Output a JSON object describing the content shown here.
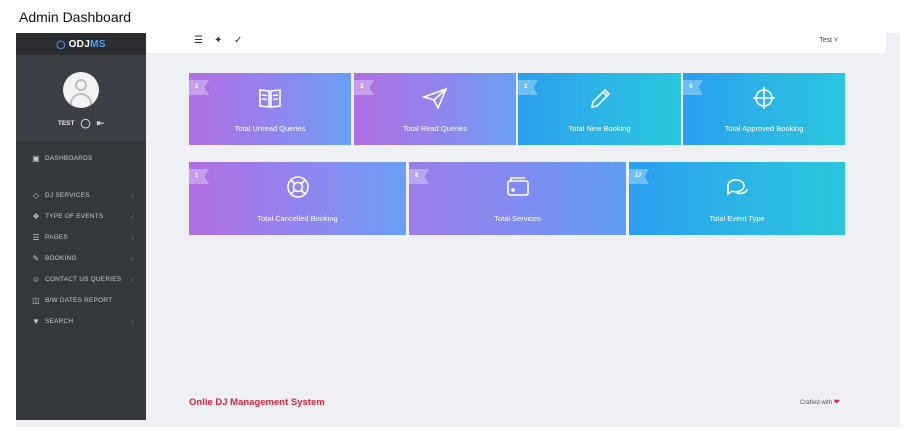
{
  "caption": "Admin Dashboard",
  "brand": {
    "prefix": "ODJ",
    "suffix": "MS"
  },
  "user": {
    "name": "TEST"
  },
  "topbar": {
    "user_menu": "Test ˅"
  },
  "menu": [
    {
      "label": "DASHBOARDS",
      "icon": "dashboard-icon",
      "chevron": false
    },
    {
      "label": "DJ SERVICES",
      "icon": "tag-icon",
      "chevron": true
    },
    {
      "label": "TYPE OF EVENTS",
      "icon": "bolt-icon",
      "chevron": true
    },
    {
      "label": "PAGES",
      "icon": "layers-icon",
      "chevron": true
    },
    {
      "label": "BOOKING",
      "icon": "edit-icon",
      "chevron": true
    },
    {
      "label": "CONTACT US QUERIES",
      "icon": "user-icon",
      "chevron": true
    },
    {
      "label": "B/W DATES REPORT",
      "icon": "calendar-icon",
      "chevron": false
    },
    {
      "label": "SEARCH",
      "icon": "filter-icon",
      "chevron": true
    }
  ],
  "cards": [
    {
      "count": "1",
      "label": "Total Unread Queries",
      "icon": "book-icon",
      "color": "#9b7de9"
    },
    {
      "count": "3",
      "label": "Total Read Queries",
      "icon": "send-icon",
      "color": "#9b7de9"
    },
    {
      "count": "2",
      "label": "Total New Booking",
      "icon": "pencil-icon",
      "color": "#2bb2e8"
    },
    {
      "count": "4",
      "label": "Total Approved Booking",
      "icon": "crosshair-icon",
      "color": "#2bb2e8"
    },
    {
      "count": "1",
      "label": "Total Cancelled Booking",
      "icon": "lifebuoy-icon",
      "color": "#9b7de9"
    },
    {
      "count": "6",
      "label": "Total Services",
      "icon": "wallet-icon",
      "color": "#8b89ef"
    },
    {
      "count": "17",
      "label": "Total Event Type",
      "icon": "chat-icon",
      "color": "#2bb2e8"
    }
  ],
  "footer": {
    "left": "Onlie DJ Management System",
    "right": "Crafted with"
  },
  "colors": {
    "sidebar": "#34373c",
    "accent_red": "#e0223c",
    "brand_blue": "#4aa3ff"
  }
}
